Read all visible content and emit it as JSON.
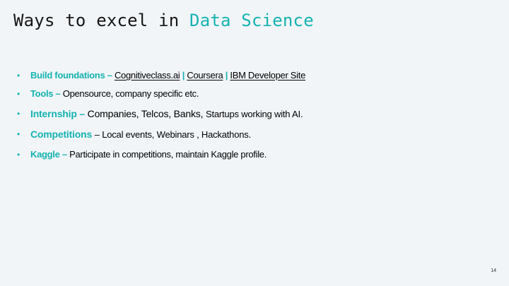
{
  "slide": {
    "title_prefix": "Ways to excel in ",
    "title_accent": "Data Science",
    "bullet_glyph": "•",
    "items": [
      {
        "lead": "Build foundations –",
        "links": [
          "Cognitiveclass.ai",
          "Coursera",
          "IBM Developer Site"
        ],
        "separator": "|"
      },
      {
        "lead": "Tools –",
        "text": "Opensource, company specific etc."
      },
      {
        "lead": "Internship –",
        "text": "Companies, Telcos, Banks,",
        "text_small": "Startups working with AI."
      },
      {
        "lead": "Competitions",
        "text": "– Local events, Webinars , Hackathons."
      },
      {
        "lead": "Kaggle –",
        "text": "Participate in competitions, maintain Kaggle profile."
      }
    ],
    "page_number": "14"
  },
  "colors": {
    "accent": "#17b3b1",
    "background": "#f1f5f8",
    "text": "#000000"
  }
}
